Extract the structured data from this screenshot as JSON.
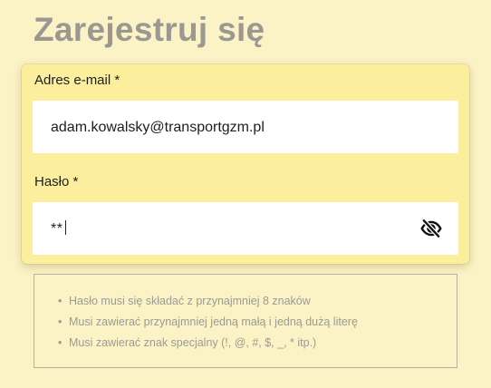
{
  "title": "Zarejestruj się",
  "form": {
    "email": {
      "label": "Adres e-mail *",
      "value": "adam.kowalsky@transportgzm.pl"
    },
    "password": {
      "label": "Hasło *",
      "value": "**",
      "visibility_icon": "eye-off-icon"
    }
  },
  "requirements": [
    "Hasło musi się składać z przynajmniej 8 znaków",
    "Musi zawierać przynajmniej jedną małą i jedną dużą literę",
    "Musi zawierać znak specjalny (!, @, #, $, _, * itp.)"
  ],
  "colors": {
    "background": "#FBF3C6",
    "card": "#FBEE9C",
    "title": "#9B9892",
    "hint_text": "#9C9A94"
  }
}
